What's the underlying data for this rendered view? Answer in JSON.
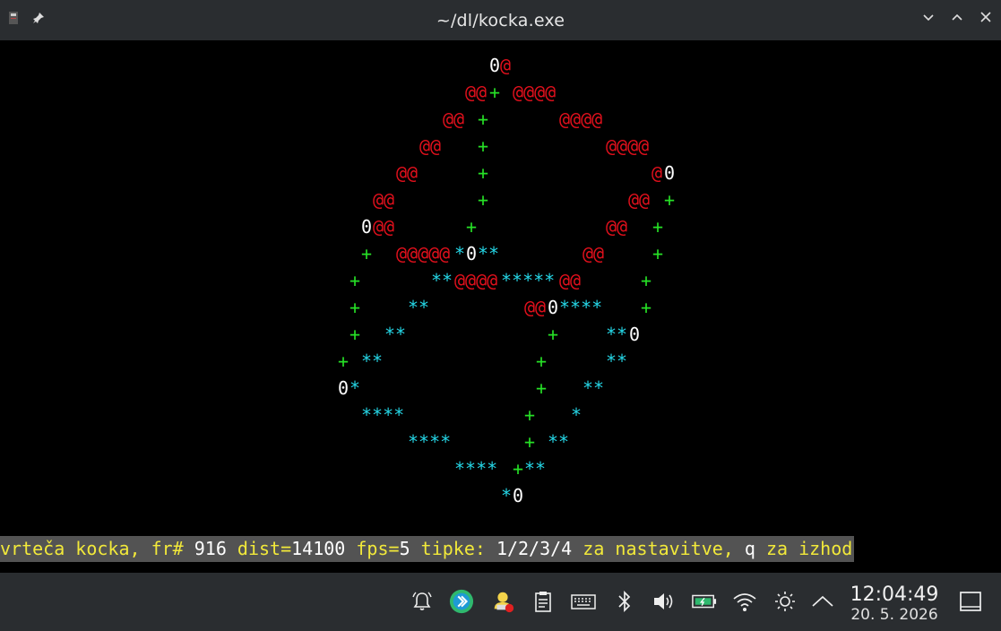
{
  "window": {
    "title": "~/dl/kocka.exe"
  },
  "terminal": {
    "cube_lines": [
      [
        {
          "t": "0",
          "c": "zero"
        },
        {
          "t": "@",
          "c": "at"
        }
      ],
      [
        {
          "t": "@@",
          "c": "at"
        },
        {
          "t": "+",
          "c": "plus"
        },
        {
          "t": "@@@@",
          "c": "at"
        }
      ],
      [
        {
          "t": "@@",
          "c": "at"
        },
        {
          "t": "+",
          "c": "plus"
        },
        {
          "t": "@@@@",
          "c": "at"
        }
      ],
      [
        {
          "t": "@@",
          "c": "at"
        },
        {
          "t": "+",
          "c": "plus"
        },
        {
          "t": "@@@@",
          "c": "at"
        }
      ],
      [
        {
          "t": "@@",
          "c": "at"
        },
        {
          "t": "+",
          "c": "plus"
        },
        {
          "t": "@",
          "c": "at"
        },
        {
          "t": "0",
          "c": "zero"
        }
      ],
      [
        {
          "t": "@@",
          "c": "at"
        },
        {
          "t": "+",
          "c": "plus"
        },
        {
          "t": "@@",
          "c": "at"
        },
        {
          "t": "+",
          "c": "plus"
        }
      ],
      [
        {
          "t": "0",
          "c": "zero"
        },
        {
          "t": "@@",
          "c": "at"
        },
        {
          "t": "+",
          "c": "plus"
        },
        {
          "t": "@@",
          "c": "at"
        },
        {
          "t": "+",
          "c": "plus"
        }
      ],
      [
        {
          "t": "+",
          "c": "plus"
        },
        {
          "t": "@@@@@",
          "c": "at"
        },
        {
          "t": "*",
          "c": "star"
        },
        {
          "t": "0",
          "c": "zero"
        },
        {
          "t": "**",
          "c": "star"
        },
        {
          "t": "@@",
          "c": "at"
        },
        {
          "t": "+",
          "c": "plus"
        }
      ],
      [
        {
          "t": "+",
          "c": "plus"
        },
        {
          "t": "**",
          "c": "star"
        },
        {
          "t": "@@@@",
          "c": "at"
        },
        {
          "t": "*****",
          "c": "star"
        },
        {
          "t": "@@",
          "c": "at"
        },
        {
          "t": "+",
          "c": "plus"
        }
      ],
      [
        {
          "t": "+",
          "c": "plus"
        },
        {
          "t": "**",
          "c": "star"
        },
        {
          "t": "@@",
          "c": "at"
        },
        {
          "t": "0",
          "c": "zero"
        },
        {
          "t": "****",
          "c": "star"
        },
        {
          "t": "+",
          "c": "plus"
        }
      ],
      [
        {
          "t": "+",
          "c": "plus"
        },
        {
          "t": "**",
          "c": "star"
        },
        {
          "t": "+",
          "c": "plus"
        },
        {
          "t": "**",
          "c": "star"
        },
        {
          "t": "0",
          "c": "zero"
        }
      ],
      [
        {
          "t": "+",
          "c": "plus"
        },
        {
          "t": "**",
          "c": "star"
        },
        {
          "t": "+",
          "c": "plus"
        },
        {
          "t": "**",
          "c": "star"
        }
      ],
      [
        {
          "t": "0",
          "c": "zero"
        },
        {
          "t": "*",
          "c": "star"
        },
        {
          "t": "+",
          "c": "plus"
        },
        {
          "t": "**",
          "c": "star"
        }
      ],
      [
        {
          "t": "****",
          "c": "star"
        },
        {
          "t": "+",
          "c": "plus"
        },
        {
          "t": "*",
          "c": "star"
        }
      ],
      [
        {
          "t": "****",
          "c": "star"
        },
        {
          "t": "+",
          "c": "plus"
        },
        {
          "t": "**",
          "c": "star"
        }
      ],
      [
        {
          "t": "****",
          "c": "star"
        },
        {
          "t": "+",
          "c": "plus"
        },
        {
          "t": "**",
          "c": "star"
        }
      ],
      [
        {
          "t": "*",
          "c": "star"
        },
        {
          "t": "0",
          "c": "zero"
        }
      ]
    ],
    "status": {
      "p1": "vrteča kocka, fr# ",
      "frame": "916",
      "p2": " dist=",
      "dist": "14100",
      "p3": " fps=",
      "fps": "5",
      "p4": " tipke: ",
      "keys": "1/2/3/4",
      "p5": " za nastavitve, ",
      "quit": "q",
      "p6": " za izhod"
    },
    "colors": {
      "at": "#e0101c",
      "plus": "#26e026",
      "star": "#25d6e6",
      "zero": "#ffffff",
      "status_bg": "#535353",
      "status_fg": "#f2e93a"
    }
  },
  "taskbar": {
    "icons": [
      "notifications-icon",
      "kde-connect-icon",
      "updates-icon",
      "clipboard-icon",
      "keyboard-icon",
      "bluetooth-icon",
      "volume-icon",
      "battery-icon",
      "wifi-icon",
      "brightness-icon",
      "expand-tray-icon",
      "show-desktop-icon"
    ],
    "time": "12:04:49",
    "date": "20. 5. 2026"
  }
}
